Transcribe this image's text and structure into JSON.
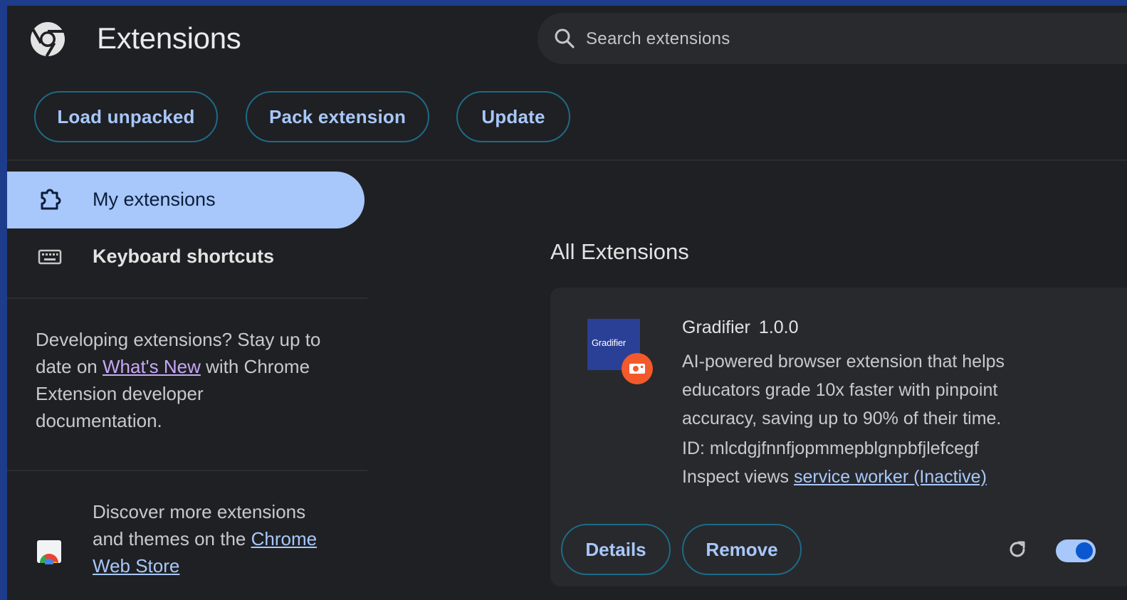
{
  "header": {
    "title": "Extensions",
    "search_placeholder": "Search extensions",
    "logo_icon": "chrome-icon"
  },
  "toolbar": {
    "load_unpacked": "Load unpacked",
    "pack_extension": "Pack extension",
    "update": "Update"
  },
  "sidebar": {
    "items": [
      {
        "label": "My extensions",
        "icon": "extension-puzzle-icon",
        "active": true
      },
      {
        "label": "Keyboard shortcuts",
        "icon": "keyboard-icon",
        "active": false
      }
    ],
    "promo": {
      "prefix": "Developing extensions? Stay up to date on ",
      "link": "What's New",
      "suffix": " with Chrome Extension developer documentation."
    },
    "store": {
      "prefix": "Discover more extensions and themes on the ",
      "link": "Chrome Web Store"
    }
  },
  "main": {
    "section_title": "All Extensions",
    "extension": {
      "icon_text": "Gradifier",
      "name": "Gradifier",
      "version": "1.0.0",
      "description": "AI-powered browser extension that helps educators grade 10x faster with pinpoint accuracy, saving up to 90% of their time.",
      "id_line": "ID: mlcdgjfnnfjopmmepblgnpbfjlefcegf",
      "inspect_label": "Inspect views",
      "inspect_link": "service worker (Inactive)",
      "details_label": "Details",
      "remove_label": "Remove",
      "enabled": true
    }
  },
  "colors": {
    "accent": "#a8c7fa",
    "background": "#1f2023",
    "card": "#28292c",
    "frame": "#1e3c8c"
  }
}
